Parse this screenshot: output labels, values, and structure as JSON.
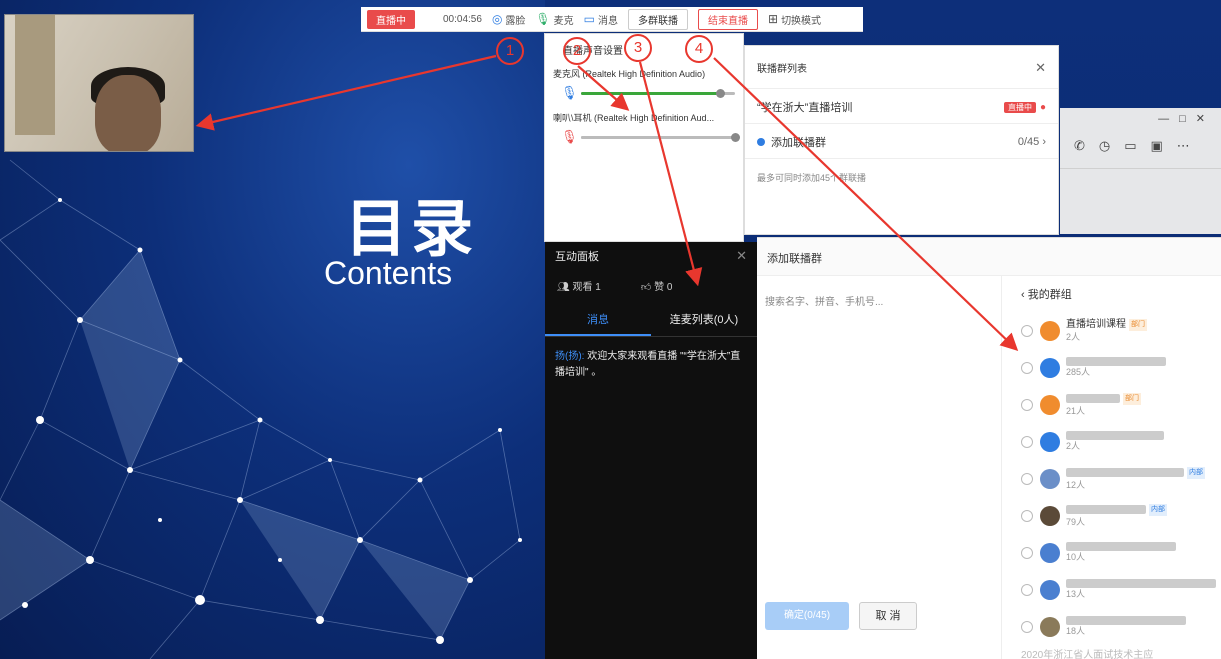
{
  "slide": {
    "title": "目录",
    "subtitle": "Contents"
  },
  "toolbar": {
    "live_badge": "直播中",
    "timer": "00:04:56",
    "beauty_label": "露脸",
    "mic_label": "麦克",
    "message_label": "消息",
    "multi_group_label": "多群联播",
    "end_live_label": "结束直播",
    "switch_mode_label": "切换模式"
  },
  "annotations": [
    "1",
    "2",
    "3",
    "4"
  ],
  "audio_settings": {
    "title": "直播声音设置",
    "microphone": {
      "label": "麦克风 (Realtek High Definition Audio)",
      "level": 0.9
    },
    "speaker": {
      "label": "喇叭\\耳机 (Realtek High Definition Aud...",
      "level": 1.0
    }
  },
  "interaction": {
    "title": "互动面板",
    "viewers": "观看 1",
    "likes": "赞 0",
    "tabs": [
      "消息",
      "连麦列表(0人)"
    ],
    "message_sender": "扬(扬):",
    "message_text": "欢迎大家来观看直播 \"“学在浙大”直播培训\" 。"
  },
  "relay_list": {
    "title": "联播群列表",
    "current_group": "“学在浙大”直播培训",
    "live_tag": "直播中",
    "add_label": "添加联播群",
    "count": "0/45",
    "hint": "最多可同时添加45个群联播"
  },
  "add_dialog": {
    "title": "添加联播群",
    "search_placeholder": "搜索名字、拼音、手机号...",
    "confirm": "确定(0/45)",
    "cancel": "取 消",
    "back_label": "‹ 我的群组",
    "groups": [
      {
        "name": "直播培训课程",
        "members": "2人",
        "tag": "部门",
        "avatar_color": "#f08c2e"
      },
      {
        "name": "",
        "members": "285人",
        "tag": "",
        "avatar_color": "#2f7de1"
      },
      {
        "name": "",
        "members": "21人",
        "tag": "部门",
        "avatar_color": "#f08c2e"
      },
      {
        "name": "",
        "members": "2人",
        "tag": "",
        "avatar_color": "#2f7de1"
      },
      {
        "name": "",
        "members": "12人",
        "tag": "内部",
        "avatar_color": "#6b8fc8"
      },
      {
        "name": "",
        "members": "79人",
        "tag": "内部",
        "avatar_color": "#5b4a38"
      },
      {
        "name": "",
        "members": "10人",
        "tag": "",
        "avatar_color": "#4a7fd0"
      },
      {
        "name": "",
        "members": "13人",
        "tag": "",
        "avatar_color": "#4a7fd0"
      },
      {
        "name": "",
        "members": "18人",
        "tag": "",
        "avatar_color": "#8a7a5a"
      }
    ],
    "footer_partial": "2020年浙江省人面试技术主应"
  }
}
